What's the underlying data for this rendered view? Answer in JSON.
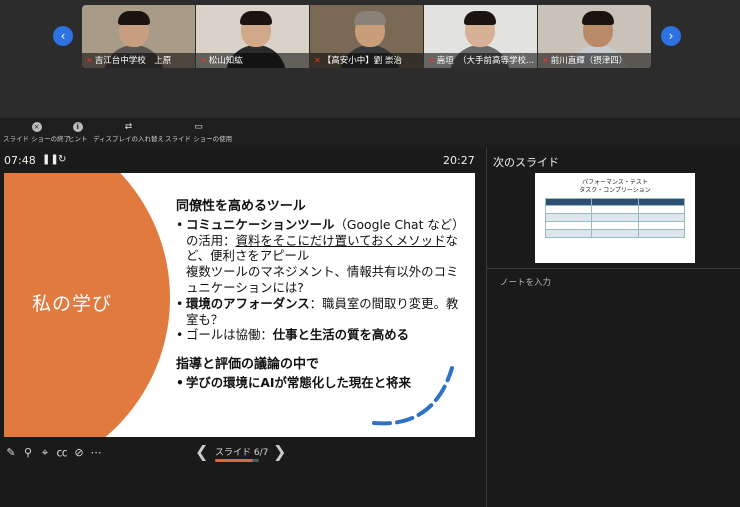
{
  "participants": [
    {
      "name": "吉江台中学校　上原"
    },
    {
      "name": "松山知紘"
    },
    {
      "name": "【高安小中】劉 崇治"
    },
    {
      "name": "嵩垣　（大手前高等学校..."
    },
    {
      "name": "前川直輝（摂津四）"
    }
  ],
  "toolbar": {
    "end_show": "スライド ショーの終了",
    "hint": "ヒント",
    "swap_display": "ディスプレイの入れ替え",
    "use_show": "スライド ショーの使用"
  },
  "presenter": {
    "elapsed": "07:48",
    "clock": "20:27",
    "slide_counter": "スライド 6/7",
    "progress_fraction": 0.857
  },
  "slide": {
    "circle_title": "私の学び",
    "heading1": "同僚性を高めるツール",
    "bullet1_bold": "コミュニケーションツール",
    "bullet1_a": "（Google Chat など）の活用：",
    "bullet1_u": "資料をそこにだけ置いておくメソッド",
    "bullet1_b": "など、便利さをアピール",
    "bullet1_c": "複数ツールのマネジメント、情報共有以外のコミュニケーションには?",
    "bullet2_bold": "環境のアフォーダンス",
    "bullet2_rest": "：職員室の間取り変更。教室も？",
    "bullet3_a": "ゴールは協働：",
    "bullet3_bold": "仕事と生活の質を高める",
    "heading2": "指導と評価の議論の中で",
    "bullet4": "学びの環境にAIが常態化した現在と将来"
  },
  "next_panel": {
    "label": "次のスライド",
    "thumb_title1": "パフォーマンス・テスト",
    "thumb_title2": "タスク・コンプリーション",
    "notes_placeholder": "ノートを入力"
  },
  "colors": {
    "accent": "#e07a3e",
    "nav_blue": "#2d72e0",
    "mic_muted": "#ee3333"
  }
}
